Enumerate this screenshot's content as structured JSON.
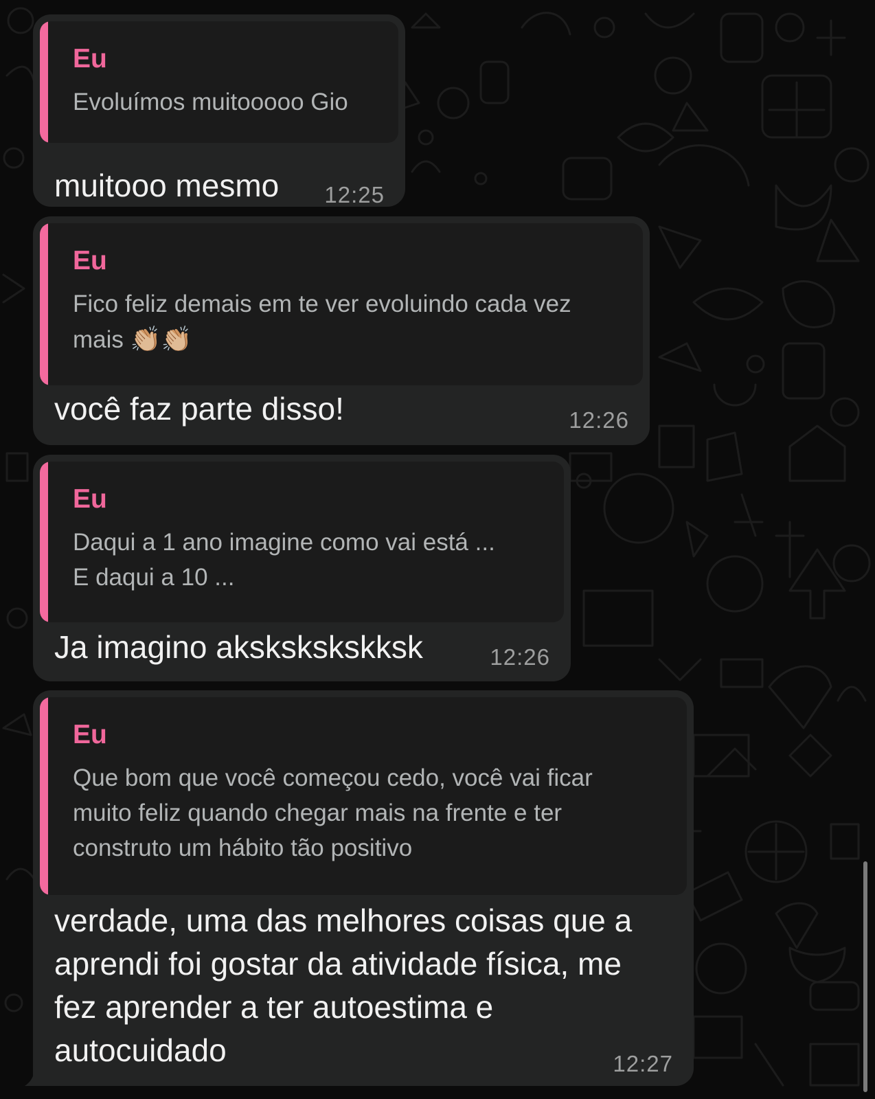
{
  "theme": {
    "background": "#0b0b0b",
    "bubble": "#232424",
    "quote_background": "#1b1b1b",
    "accent": "#f0679b",
    "text": "#f1f1f1",
    "muted": "#9e9f9f"
  },
  "messages": [
    {
      "quote": {
        "author": "Eu",
        "text": "Evoluímos muitooooo Gio"
      },
      "text": "muitooo mesmo",
      "time": "12:25"
    },
    {
      "quote": {
        "author": "Eu",
        "text": "Fico feliz demais em te ver evoluindo cada vez\nmais",
        "emoji": "👏🏼👏🏼",
        "emoji_icon": "clapping-hands-icon"
      },
      "text": "você faz parte disso!",
      "time": "12:26"
    },
    {
      "quote": {
        "author": "Eu",
        "text": "Daqui a 1 ano imagine como vai está ...\nE daqui a 10 ..."
      },
      "text": "Ja imagino akskskskskksk",
      "time": "12:26"
    },
    {
      "quote": {
        "author": "Eu",
        "text": "Que bom que você começou cedo, você vai ficar\nmuito feliz quando chegar mais na frente e ter\nconstruto um hábito tão positivo"
      },
      "text_lines": [
        "verdade, uma das melhores coisas que a",
        "aprendi foi gostar da atividade física, me",
        "fez aprender a ter autoestima e",
        "autocuidado"
      ],
      "time": "12:27"
    }
  ]
}
